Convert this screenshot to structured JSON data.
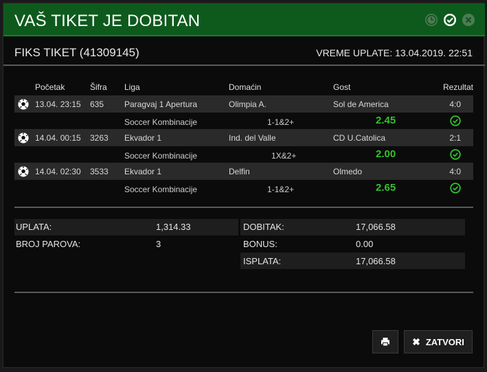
{
  "modal": {
    "title": "VAŠ TIKET JE DOBITAN",
    "ticket_label": "FIKS TIKET (41309145)",
    "payment_time": "VREME UPLATE: 13.04.2019. 22:51",
    "header_icons": [
      "clock-icon",
      "check-circle-icon",
      "close-circle-icon"
    ]
  },
  "table": {
    "headers": {
      "start": "Početak",
      "code": "Šifra",
      "league": "Liga",
      "home": "Domaćin",
      "away": "Gost",
      "result": "Rezultat"
    },
    "matches": [
      {
        "time": "13.04. 23:15",
        "code": "635",
        "league": "Paragvaj 1 Apertura",
        "home": "Olimpia A.",
        "away": "Sol de America",
        "result": "4:0",
        "bet_type": "Soccer Kombinacije",
        "pick": "1-1&2+",
        "odd": "2.45"
      },
      {
        "time": "14.04. 00:15",
        "code": "3263",
        "league": "Ekvador 1",
        "home": "Ind. del Valle",
        "away": "CD U.Catolica",
        "result": "2:1",
        "bet_type": "Soccer Kombinacije",
        "pick": "1X&2+",
        "odd": "2.00"
      },
      {
        "time": "14.04. 02:30",
        "code": "3533",
        "league": "Ekvador 1",
        "home": "Delfin",
        "away": "Olmedo",
        "result": "4:0",
        "bet_type": "Soccer Kombinacije",
        "pick": "1-1&2+",
        "odd": "2.65"
      }
    ]
  },
  "summary": {
    "stake_label": "UPLATA:",
    "stake_value": "1,314.33",
    "pairs_label": "BROJ PAROVA:",
    "pairs_value": "3",
    "win_label": "DOBITAK:",
    "win_value": "17,066.58",
    "bonus_label": "BONUS:",
    "bonus_value": "0.00",
    "payout_label": "ISPLATA:",
    "payout_value": "17,066.58"
  },
  "buttons": {
    "print_icon": "print-icon",
    "close_label": "ZATVORI"
  },
  "colors": {
    "header_green": "#0e5a1d",
    "odd_green": "#33c22c",
    "check_green": "#2ec32a"
  }
}
